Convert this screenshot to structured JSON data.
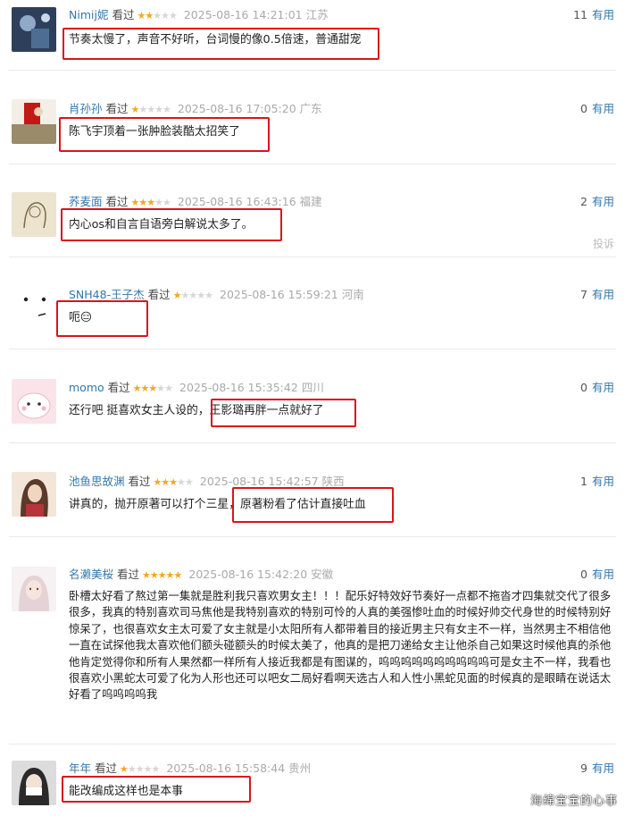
{
  "comments": [
    {
      "user": "Nimij妮",
      "watched": "看过",
      "stars": 2,
      "time": "2025-08-16 14:21:01",
      "location": "江苏",
      "useful_count": "11",
      "useful_label": "有用",
      "text": "节奏太慢了，声音不好听，台词慢的像0.5倍速，普通甜宠"
    },
    {
      "user": "肖孙孙",
      "watched": "看过",
      "stars": 1,
      "time": "2025-08-16 17:05:20",
      "location": "广东",
      "useful_count": "0",
      "useful_label": "有用",
      "text": "陈飞宇顶着一张肿脸装酷太招笑了"
    },
    {
      "user": "荞麦面",
      "watched": "看过",
      "stars": 3,
      "time": "2025-08-16 16:43:16",
      "location": "福建",
      "useful_count": "2",
      "useful_label": "有用",
      "text": "内心os和自言自语旁白解说太多了。",
      "report": "投诉"
    },
    {
      "user": "SNH48-王子杰",
      "watched": "看过",
      "stars": 1,
      "time": "2025-08-16 15:59:21",
      "location": "河南",
      "useful_count": "7",
      "useful_label": "有用",
      "text": "呃😑"
    },
    {
      "user": "momo",
      "watched": "看过",
      "stars": 3,
      "time": "2025-08-16 15:35:42",
      "location": "四川",
      "useful_count": "0",
      "useful_label": "有用",
      "text": "还行吧 挺喜欢女主人设的，王影璐再胖一点就好了"
    },
    {
      "user": "池鱼思故渊",
      "watched": "看过",
      "stars": 3,
      "time": "2025-08-16 15:42:57",
      "location": "陕西",
      "useful_count": "1",
      "useful_label": "有用",
      "text": "讲真的，抛开原著可以打个三星，原著粉看了估计直接吐血"
    },
    {
      "user": "名濑美桜",
      "watched": "看过",
      "stars": 5,
      "time": "2025-08-16 15:42:20",
      "location": "安徽",
      "useful_count": "0",
      "useful_label": "有用",
      "text": "卧槽太好看了熬过第一集就是胜利我只喜欢男女主！！！配乐好特效好节奏好一点都不拖沓才四集就交代了很多很多，我真的特别喜欢司马焦他是我特别喜欢的特别可怜的人真的美强惨吐血的时候好帅交代身世的时候特别好惊呆了，也很喜欢女主太可爱了女主就是小太阳所有人都带着目的接近男主只有女主不一样，当然男主不相信他一直在试探他我太喜欢他们额头碰额头的时候太美了，他真的是把刀递给女主让他杀自己如果这时候他真的杀他他肯定觉得你和所有人果然都一样所有人接近我都是有图谋的，呜呜呜呜呜呜呜呜呜呜可是女主不一样，我看也很喜欢小黑蛇太可爱了化为人形也还可以吧女二局好看啊天选古人和人性小黑蛇见面的时候真的是眼睛在说话太好看了呜呜呜呜我"
    },
    {
      "user": "年年",
      "watched": "看过",
      "stars": 1,
      "time": "2025-08-16 15:58:44",
      "location": "贵州",
      "useful_count": "9",
      "useful_label": "有用",
      "text": "能改编成这样也是本事"
    }
  ],
  "watermark": "海绵宝宝的心事",
  "colors": {
    "link": "#3377aa",
    "star": "#f5a623",
    "highlight_box": "#d9141b"
  }
}
